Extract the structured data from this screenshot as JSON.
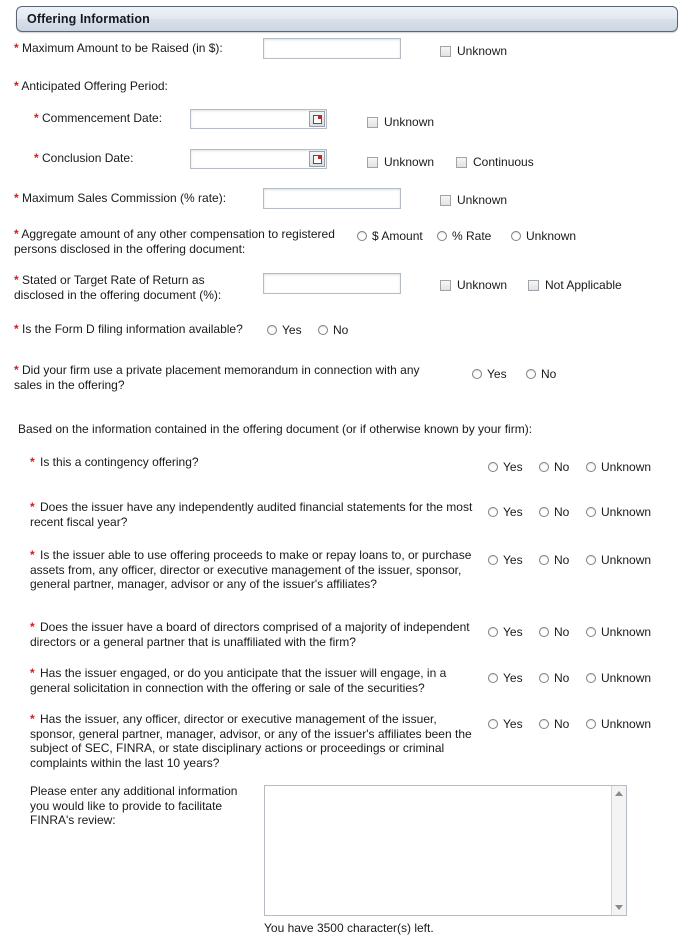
{
  "section": {
    "title": "Offering Information"
  },
  "fields": {
    "max_amount": {
      "label": "Maximum Amount to be Raised (in $):",
      "value": "",
      "unknown_label": "Unknown"
    },
    "anticipated_period": {
      "label": "Anticipated Offering Period:"
    },
    "commencement_date": {
      "label": "Commencement Date:",
      "value": "",
      "unknown_label": "Unknown",
      "calendar_icon": "calendar-icon"
    },
    "conclusion_date": {
      "label": "Conclusion Date:",
      "value": "",
      "unknown_label": "Unknown",
      "continuous_label": "Continuous",
      "calendar_icon": "calendar-icon"
    },
    "max_sales_commission": {
      "label": "Maximum Sales Commission (% rate):",
      "value": "",
      "unknown_label": "Unknown"
    },
    "aggregate_compensation": {
      "label": "Aggregate amount of any other compensation to registered\npersons disclosed in the offering document:",
      "options": [
        "$ Amount",
        "% Rate",
        "Unknown"
      ]
    },
    "target_rate_of_return": {
      "label": "Stated or Target Rate of Return as\ndisclosed in the offering document (%):",
      "value": "",
      "unknown_label": "Unknown",
      "not_applicable_label": "Not Applicable"
    },
    "form_d_available": {
      "label": "Is the Form D filing information available?",
      "options": [
        "Yes",
        "No"
      ]
    },
    "private_placement_memo": {
      "label": "Did your firm use a private placement memorandum in connection with any\nsales in the offering?",
      "options": [
        "Yes",
        "No"
      ]
    }
  },
  "intro_note": "Based on the information contained in the offering document (or if otherwise known by your firm):",
  "questions": [
    {
      "text": "Is this a contingency offering?",
      "options": [
        "Yes",
        "No",
        "Unknown"
      ]
    },
    {
      "text": "Does the issuer have any independently audited financial statements for the most recent fiscal year?",
      "options": [
        "Yes",
        "No",
        "Unknown"
      ]
    },
    {
      "text": "Is the issuer able to use offering proceeds to make or repay loans to, or purchase assets from, any officer, director or executive management of the issuer, sponsor, general partner, manager, advisor or any of the issuer's affiliates?",
      "options": [
        "Yes",
        "No",
        "Unknown"
      ]
    },
    {
      "text": "Does the issuer have a board of directors comprised of a majority of independent directors or a general partner that is unaffiliated with the firm?",
      "options": [
        "Yes",
        "No",
        "Unknown"
      ]
    },
    {
      "text": "Has the issuer engaged, or do you anticipate that the issuer will engage, in a general solicitation in connection with the offering or sale of the securities?",
      "options": [
        "Yes",
        "No",
        "Unknown"
      ]
    },
    {
      "text": "Has the issuer, any officer, director or executive management of the issuer, sponsor, general partner, manager, advisor, or any of the issuer's affiliates been the subject of SEC, FINRA, or state disciplinary actions or proceedings or criminal complaints within the last 10 years?",
      "options": [
        "Yes",
        "No",
        "Unknown"
      ]
    }
  ],
  "additional_info": {
    "label": "Please enter any additional information\nyou would like to provide to facilitate\nFINRA's review:",
    "value": "",
    "counter": "You have 3500 character(s) left."
  },
  "colors": {
    "required_asterisk": "#d21d26",
    "header_border": "#5a6473",
    "input_border": "#b6bcc4"
  }
}
